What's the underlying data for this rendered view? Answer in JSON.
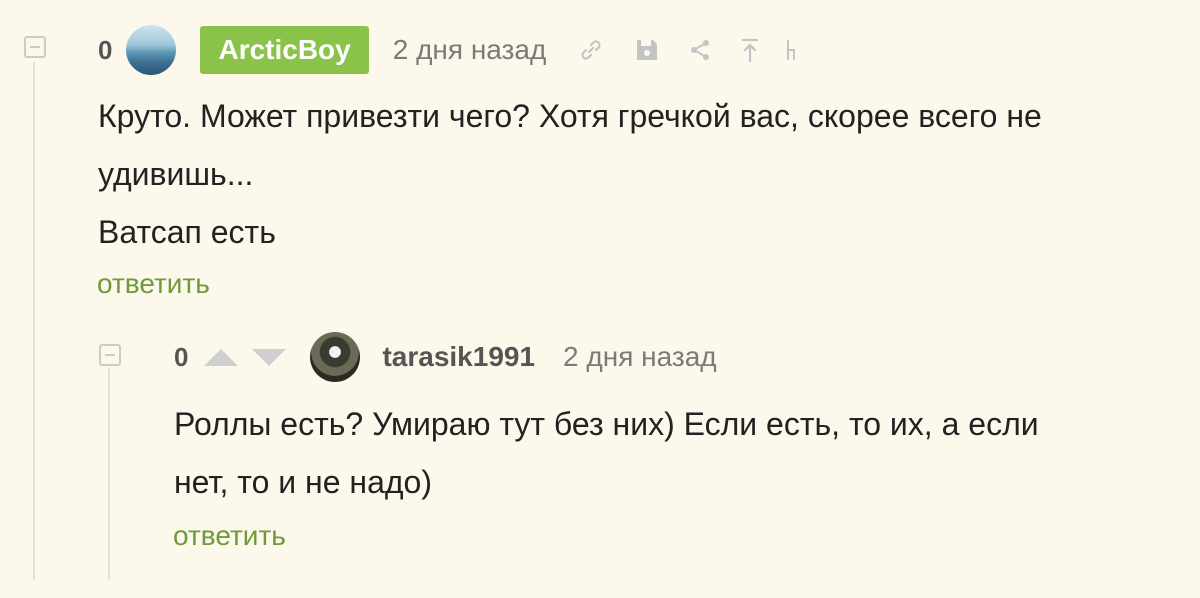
{
  "comments": [
    {
      "rating": "0",
      "author": "ArcticBoy",
      "time": "2 дня назад",
      "icons": [
        "link-icon",
        "save-icon",
        "share-icon",
        "scroll-up-icon",
        "branch-icon"
      ],
      "lines": [
        "Круто. Может привезти чего? Хотя гречкой вас, скорее всего не",
        "удивишь...",
        "Ватсап есть"
      ],
      "reply": "ответить"
    },
    {
      "rating": "0",
      "author": "tarasik1991",
      "time": "2 дня назад",
      "icons": [
        "vote-up-icon",
        "vote-down-icon"
      ],
      "lines": [
        "Роллы есть? Умираю тут без них) Если есть, то их, а если",
        "нет, то и не надо)"
      ],
      "reply": "ответить"
    }
  ]
}
